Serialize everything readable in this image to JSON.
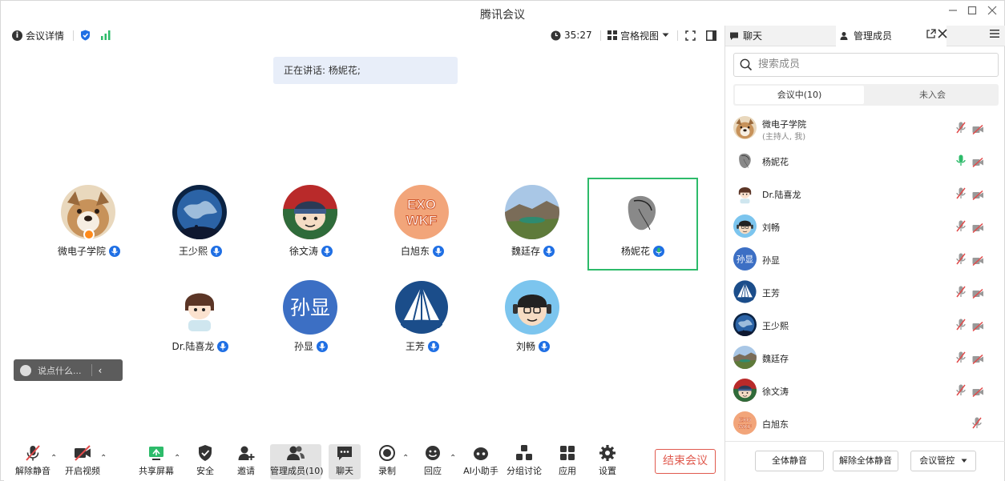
{
  "window": {
    "title": "腾讯会议",
    "min_icon": "minimize-icon",
    "max_icon": "maximize-icon",
    "close_icon": "close-icon"
  },
  "topbar": {
    "meeting_details": "会议详情",
    "timer": "35:27",
    "view_label": "宫格视图"
  },
  "speaking": "正在讲话: 杨妮花;",
  "participants": [
    {
      "name": "微电子学院",
      "host": true,
      "avatar": "dog"
    },
    {
      "name": "王少熙",
      "avatar": "earth"
    },
    {
      "name": "徐文涛",
      "avatar": "cartoon-beanie"
    },
    {
      "name": "白旭东",
      "avatar": "orange-graffiti"
    },
    {
      "name": "魏廷存",
      "avatar": "landscape"
    },
    {
      "name": "杨妮花",
      "avatar": "sketch",
      "active": true,
      "mic_color": "green"
    },
    {
      "name": "Dr.陆喜龙",
      "avatar": "anime-boy"
    },
    {
      "name": "孙显",
      "avatar": "text",
      "avatar_text": "孙显"
    },
    {
      "name": "王芳",
      "avatar": "sail-logo"
    },
    {
      "name": "刘畅",
      "avatar": "cartoon-headphones"
    }
  ],
  "chat_input": {
    "placeholder": "说点什么..."
  },
  "toolbar": {
    "unmute": "解除静音",
    "video": "开启视频",
    "share": "共享屏幕",
    "security": "安全",
    "invite": "邀请",
    "members": "管理成员(10)",
    "chat": "聊天",
    "record": "录制",
    "react": "回应",
    "ai": "AI小助手",
    "breakout": "分组讨论",
    "apps": "应用",
    "settings": "设置",
    "end": "结束会议"
  },
  "side": {
    "tab_chat": "聊天",
    "tab_members": "管理成员",
    "search_placeholder": "搜索成员",
    "seg_in": "会议中(10)",
    "seg_out": "未入会",
    "members": [
      {
        "name": "微电子学院",
        "sub": "(主持人, 我)",
        "avatar": "dog",
        "mic": "muted"
      },
      {
        "name": "杨妮花",
        "avatar": "sketch",
        "mic": "on"
      },
      {
        "name": "Dr.陆喜龙",
        "avatar": "anime-boy",
        "mic": "muted"
      },
      {
        "name": "刘畅",
        "avatar": "cartoon-headphones",
        "mic": "muted"
      },
      {
        "name": "孙显",
        "avatar": "text",
        "avatar_text": "孙显",
        "mic": "muted"
      },
      {
        "name": "王芳",
        "avatar": "sail-logo",
        "mic": "muted"
      },
      {
        "name": "王少熙",
        "avatar": "earth",
        "mic": "muted"
      },
      {
        "name": "魏廷存",
        "avatar": "landscape",
        "mic": "muted"
      },
      {
        "name": "徐文涛",
        "avatar": "cartoon-beanie",
        "mic": "muted"
      },
      {
        "name": "白旭东",
        "avatar": "orange-graffiti",
        "mic": "muted"
      }
    ],
    "footer": {
      "mute_all": "全体静音",
      "unmute_all": "解除全体静音",
      "controls": "会议管控"
    }
  },
  "colors": {
    "accent": "#1f6fe4",
    "active_border": "#2dbb6a",
    "end_red": "#e05a4e",
    "muted_red": "#e04b4b"
  }
}
